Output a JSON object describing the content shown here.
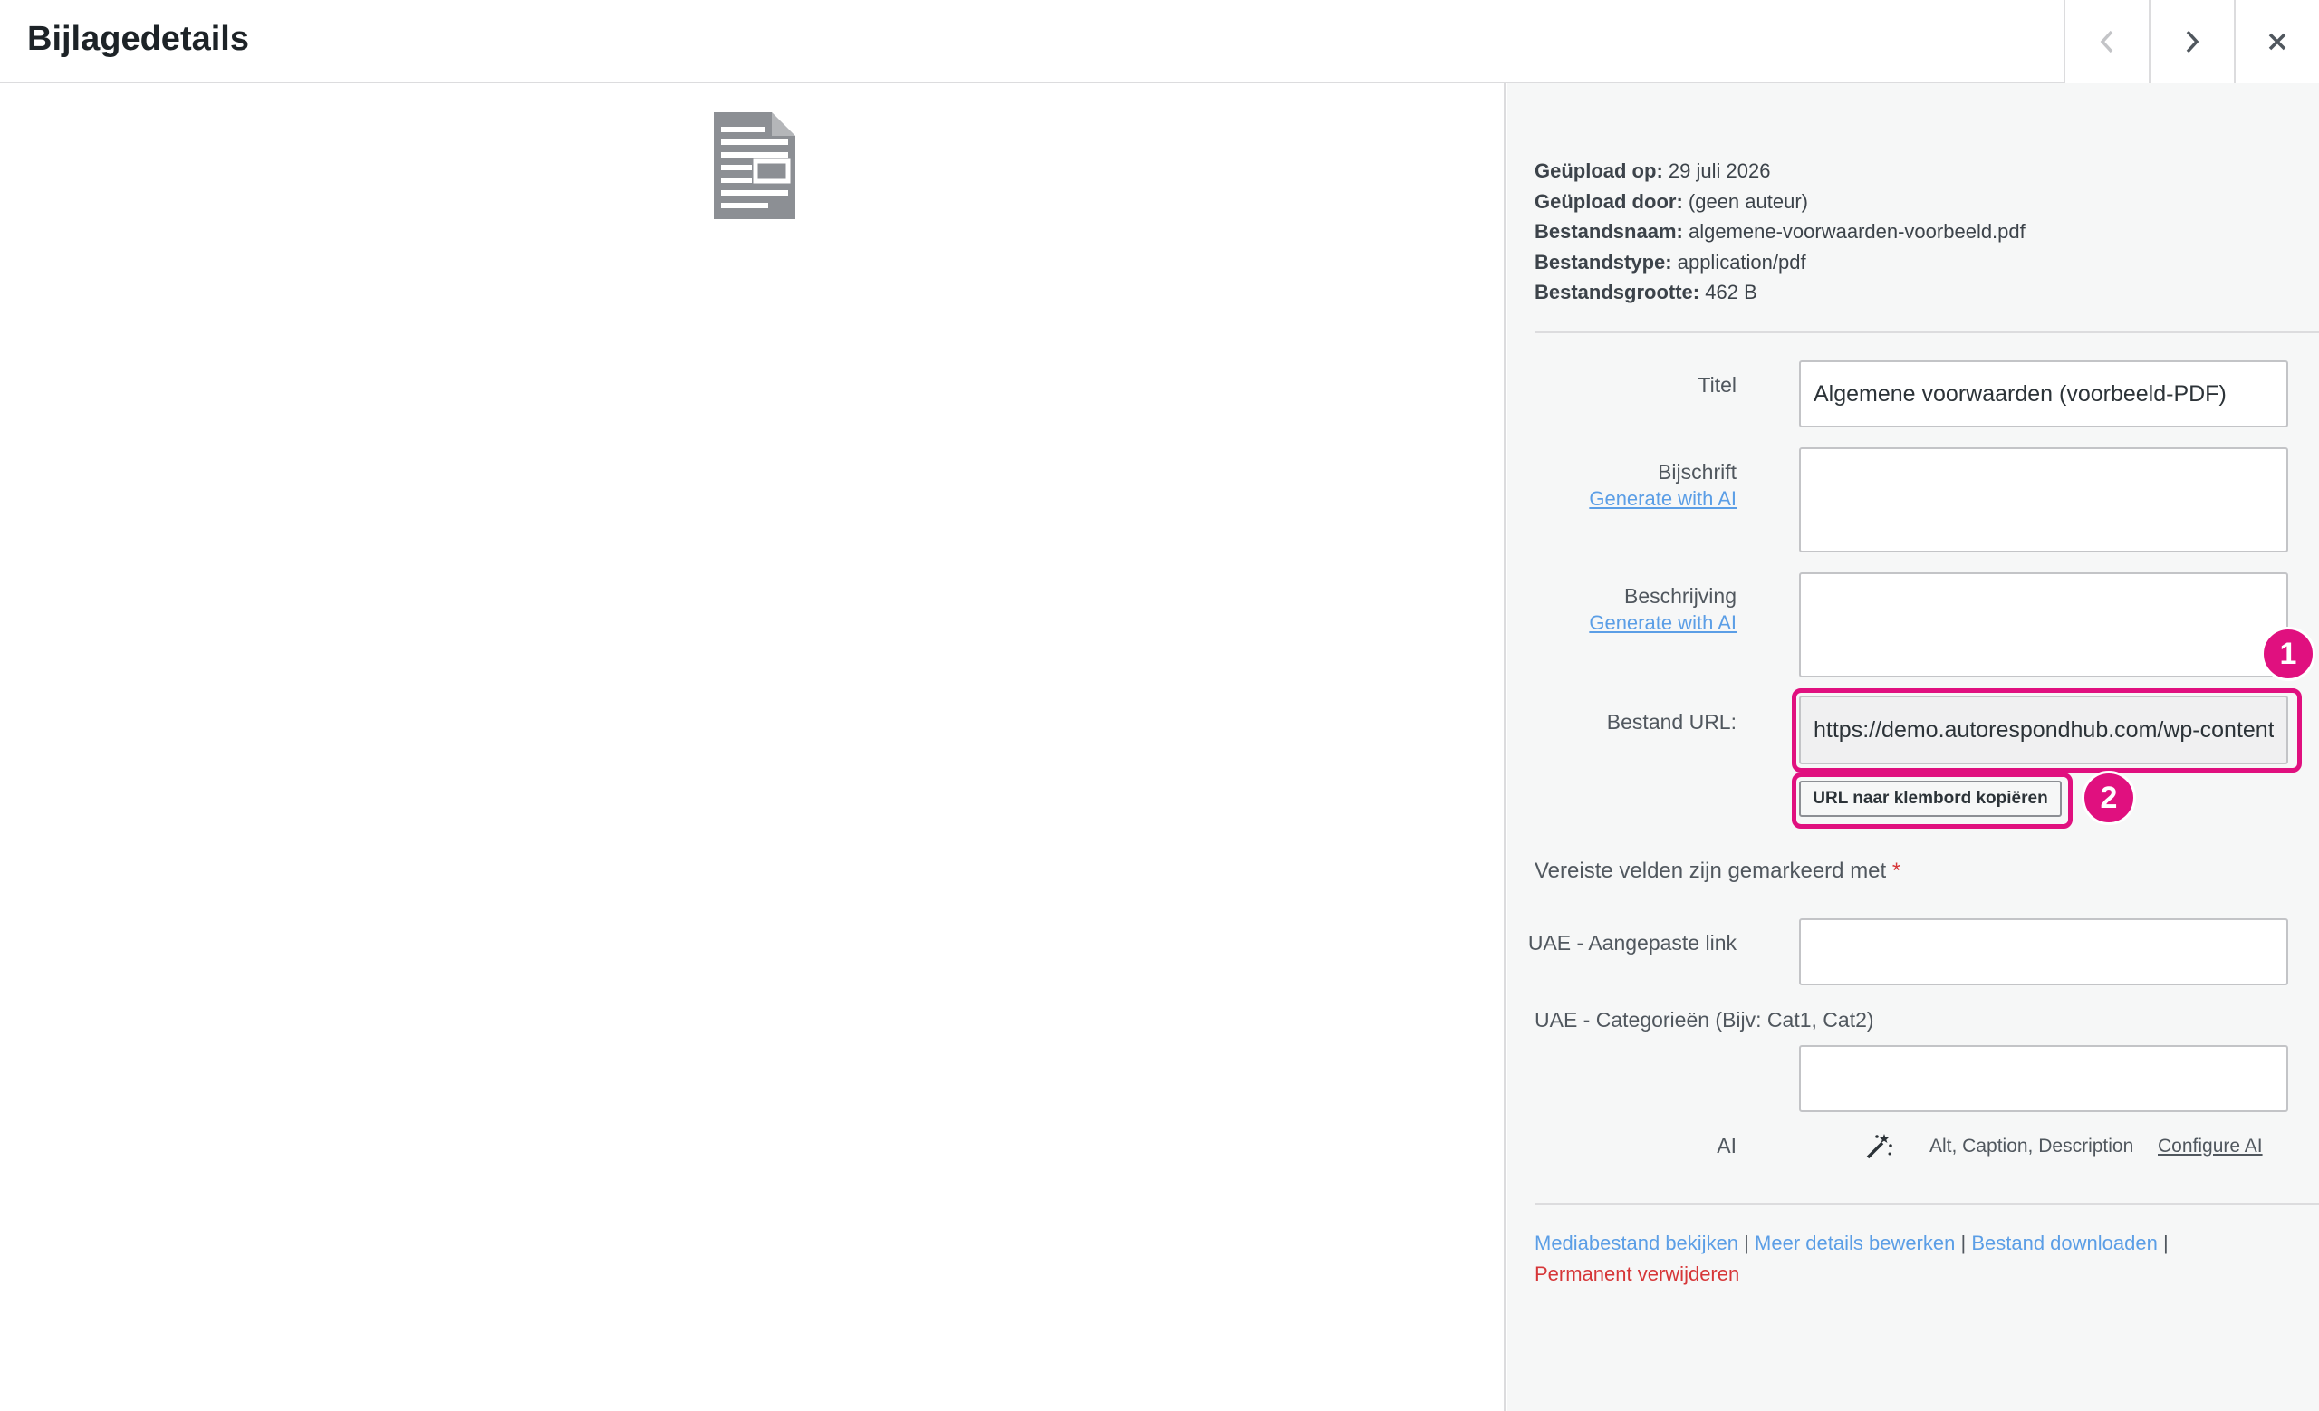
{
  "header": {
    "title": "Bijlagedetails"
  },
  "meta": [
    {
      "label": "Geüpload op:",
      "value": "29 juli 2026"
    },
    {
      "label": "Geüpload door:",
      "value": "(geen auteur)"
    },
    {
      "label": "Bestandsnaam:",
      "value": "algemene-voorwaarden-voorbeeld.pdf"
    },
    {
      "label": "Bestandstype:",
      "value": "application/pdf"
    },
    {
      "label": "Bestandsgrootte:",
      "value": "462 B"
    }
  ],
  "fields": {
    "title_label": "Titel",
    "title_value": "Algemene voorwaarden (voorbeeld-PDF)",
    "caption_label": "Bijschrift",
    "caption_generate": "Generate with AI",
    "description_label": "Beschrijving",
    "description_generate": "Generate with AI",
    "url_label": "Bestand URL:",
    "url_value": "https://demo.autorespondhub.com/wp-content/uploads/algemene-voorwaarden-voorbeeld.pdf",
    "copy_button": "URL naar klembord kopiëren"
  },
  "annotations": {
    "badge1": "1",
    "badge2": "2",
    "color": "#e0107f"
  },
  "required_note": {
    "text": "Vereiste velden zijn gemarkeerd met",
    "star": "*"
  },
  "uae": {
    "link_label": "UAE - Aangepaste link",
    "categories_label": "UAE - Categorieën (Bijv: Cat1, Cat2)"
  },
  "ai": {
    "label": "AI",
    "icon": "magic-wand-icon",
    "features": "Alt, Caption, Description",
    "configure_link": "Configure AI"
  },
  "actions": {
    "view": "Mediabestand bekijken",
    "edit": "Meer details bewerken",
    "download": "Bestand downloaden",
    "separator": "|",
    "delete": "Permanent verwijderen"
  }
}
